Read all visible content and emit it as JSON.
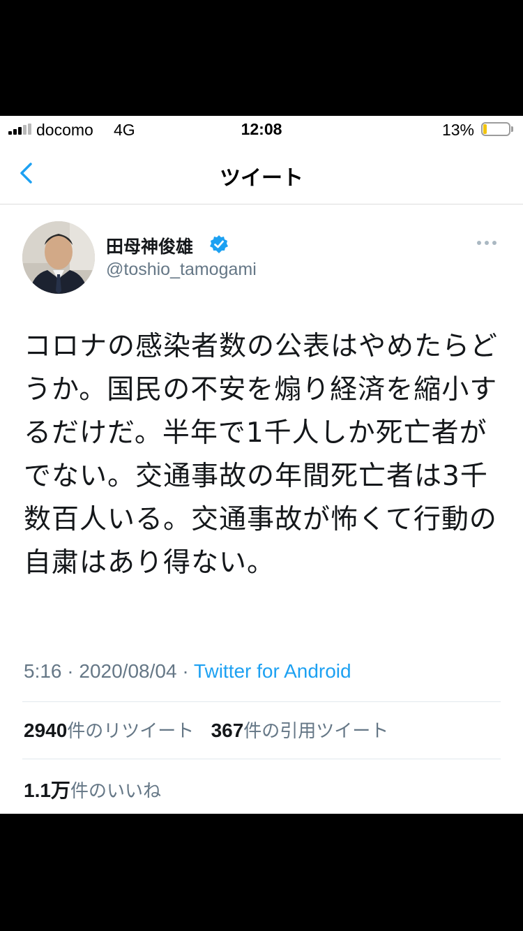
{
  "status_bar": {
    "carrier": "docomo",
    "network": "4G",
    "time": "12:08",
    "battery_percent": "13%",
    "battery_level": 0.13,
    "battery_color": "#f1c40f"
  },
  "nav": {
    "back_icon": "chevron-left-icon",
    "title": "ツイート"
  },
  "tweet": {
    "display_name": "田母神俊雄",
    "verified_icon": "verified-badge-icon",
    "handle": "@toshio_tamogami",
    "text": "コロナの感染者数の公表はやめたらどうか。国民の不安を煽り経済を縮小するだけだ。半年で1千人しか死亡者がでない。交通事故の年間死亡者は3千数百人いる。交通事故が怖くて行動の自粛はあり得ない。",
    "time": "5:16",
    "separator": "·",
    "date": "2020/08/04",
    "source": "Twitter for Android"
  },
  "stats": {
    "retweets_count": "2940",
    "retweets_label": "件のリツイート",
    "quotes_count": "367",
    "quotes_label": "件の引用ツイート",
    "likes_count": "1.1万",
    "likes_label": "件のいいね"
  },
  "colors": {
    "link": "#1da1f2",
    "secondary_text": "#657786",
    "accent": "#1da1f2"
  }
}
